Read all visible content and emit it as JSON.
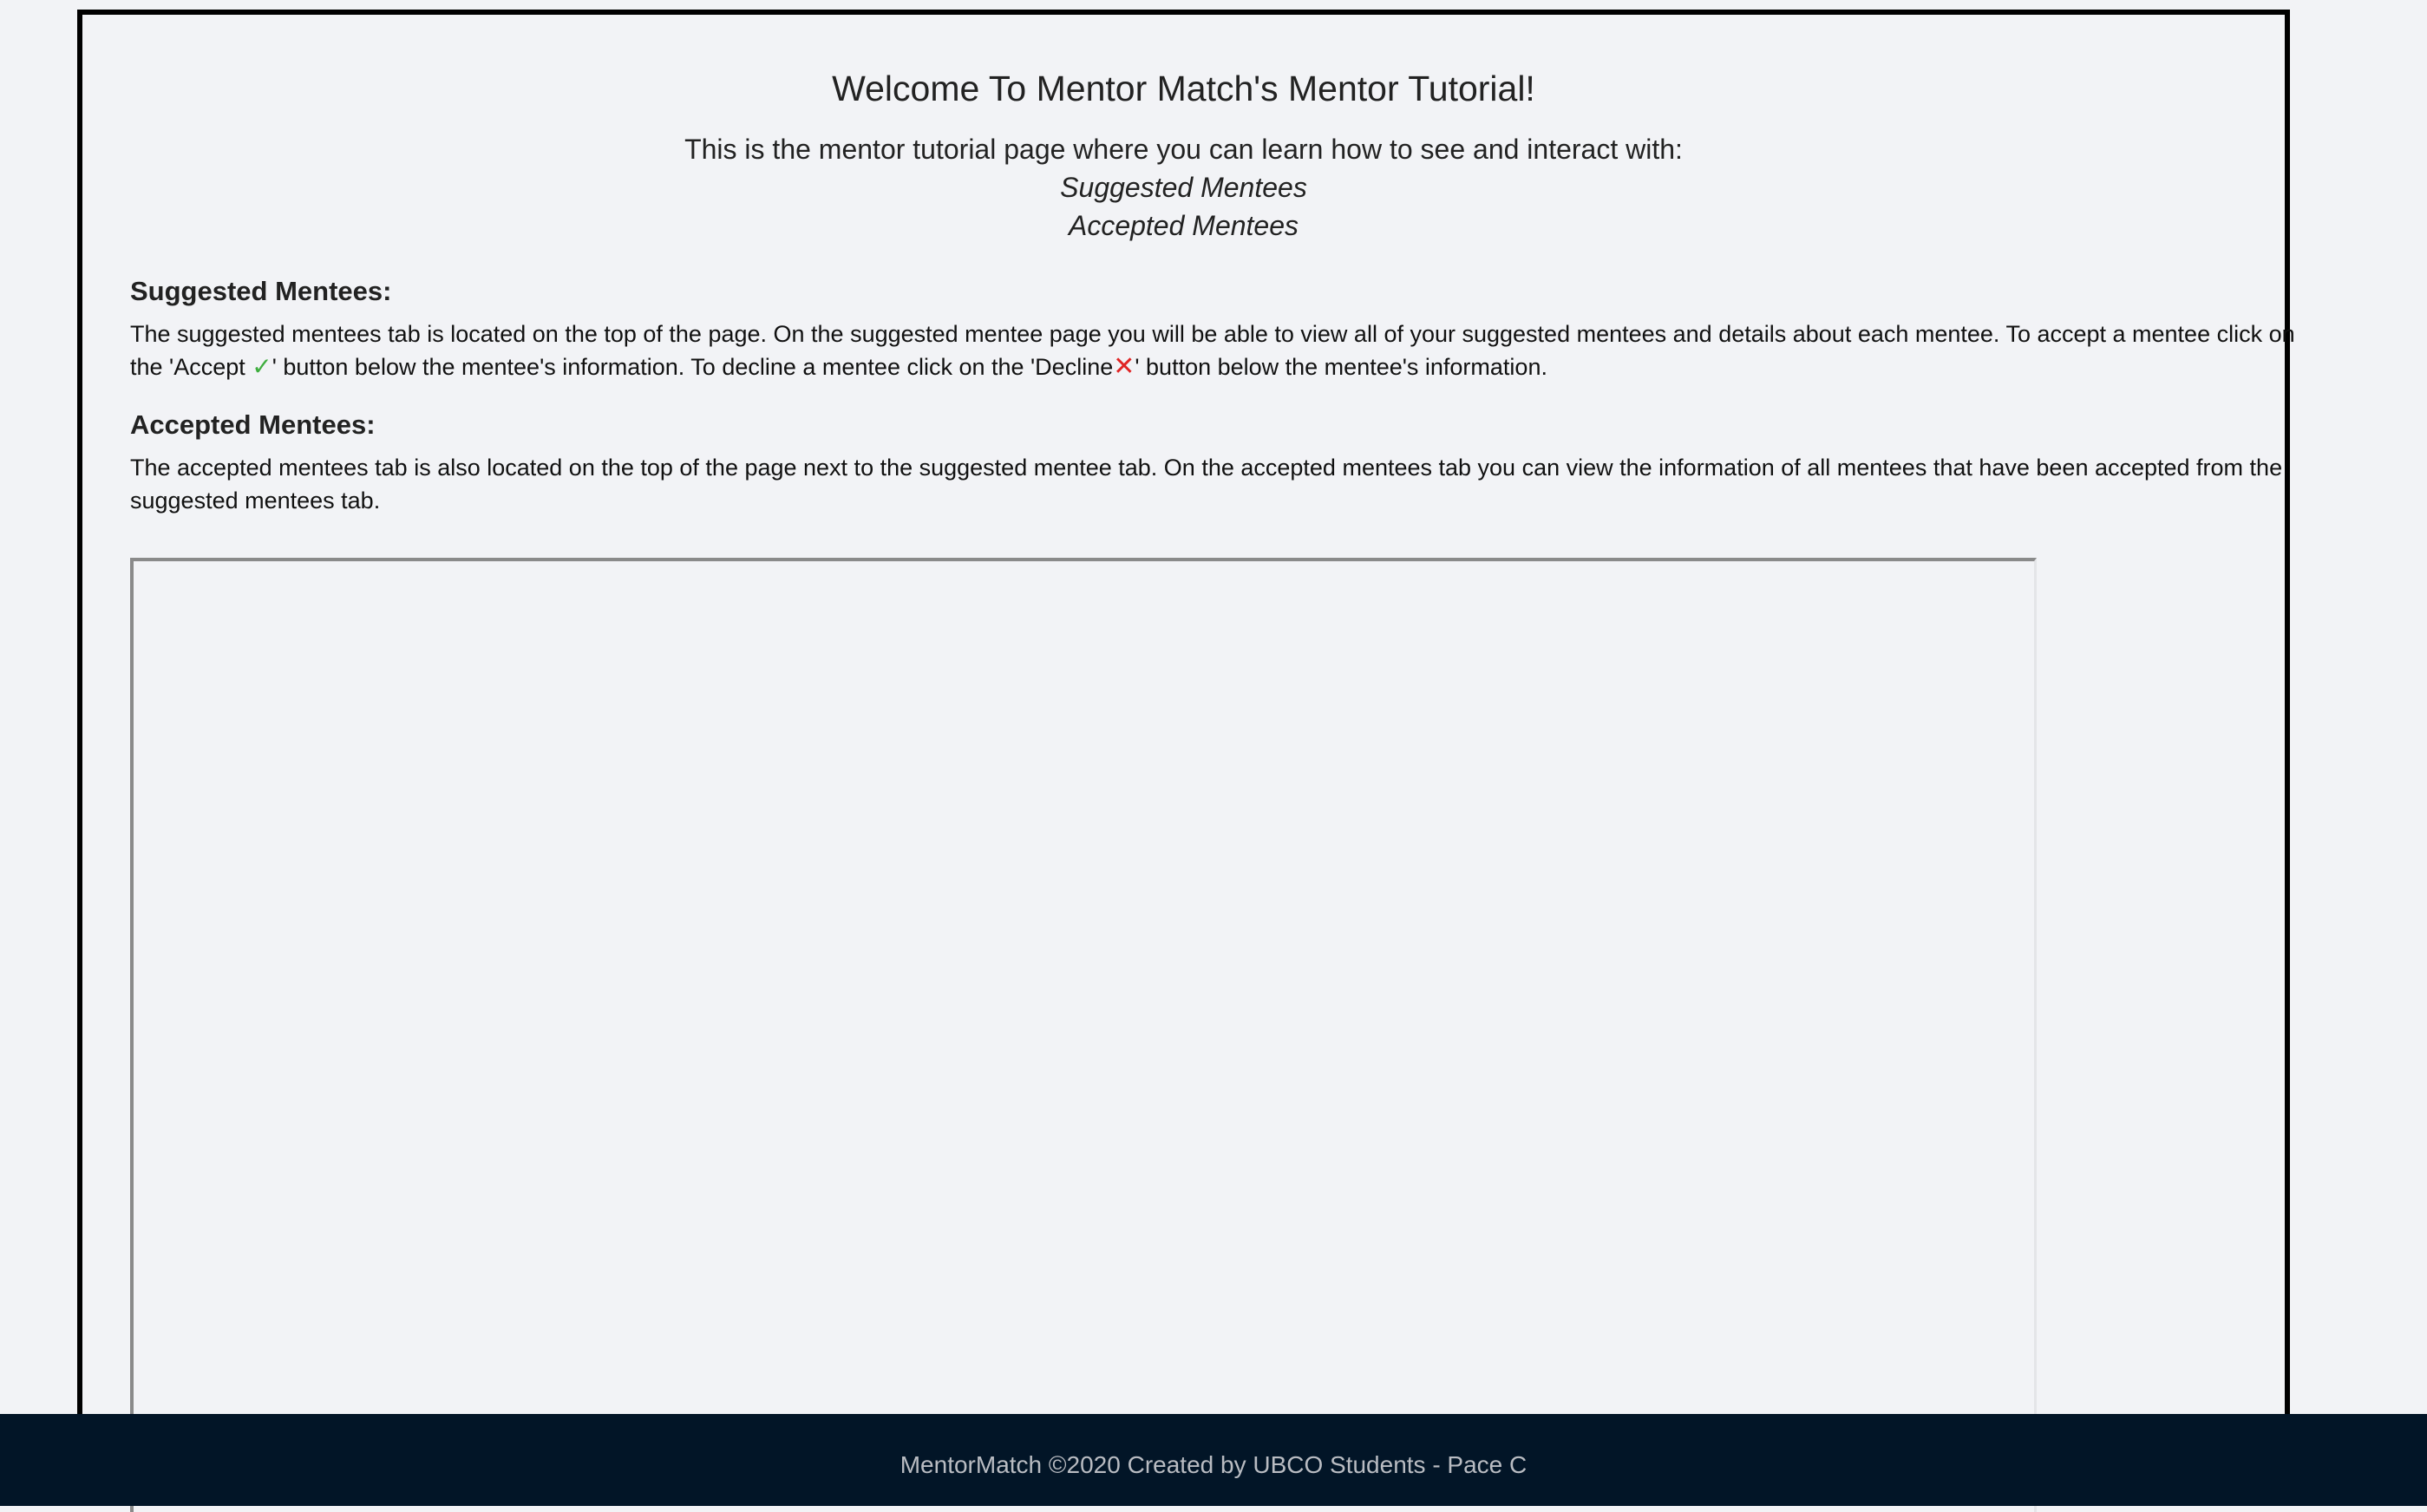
{
  "header": {
    "title": "Welcome To Mentor Match's Mentor Tutorial!",
    "intro": "This is the mentor tutorial page where you can learn how to see and interact with:",
    "topics": [
      "Suggested Mentees",
      "Accepted Mentees"
    ]
  },
  "sections": {
    "suggested": {
      "heading": "Suggested Mentees:",
      "text_part1": "The suggested mentees tab is located on the top of the page. On the suggested mentee page you will be able to view all of your suggested mentees and details about each mentee. To accept a mentee click on the 'Accept ",
      "accept_symbol": "✓",
      "text_part2": "' button below the mentee's information. To decline a mentee click on the 'Decline",
      "decline_symbol": "✕",
      "text_part3": "' button below the mentee's information."
    },
    "accepted": {
      "heading": "Accepted Mentees:",
      "text": "The accepted mentees tab is also located on the top of the page next to the suggested mentee tab. On the accepted mentees tab you can view the information of all mentees that have been accepted from the suggested mentees tab."
    }
  },
  "footer": {
    "text": "MentorMatch ©2020 Created by UBCO Students - Pace C"
  },
  "colors": {
    "accept": "#3fae3f",
    "decline": "#e02424",
    "footer_bg": "#021527"
  }
}
